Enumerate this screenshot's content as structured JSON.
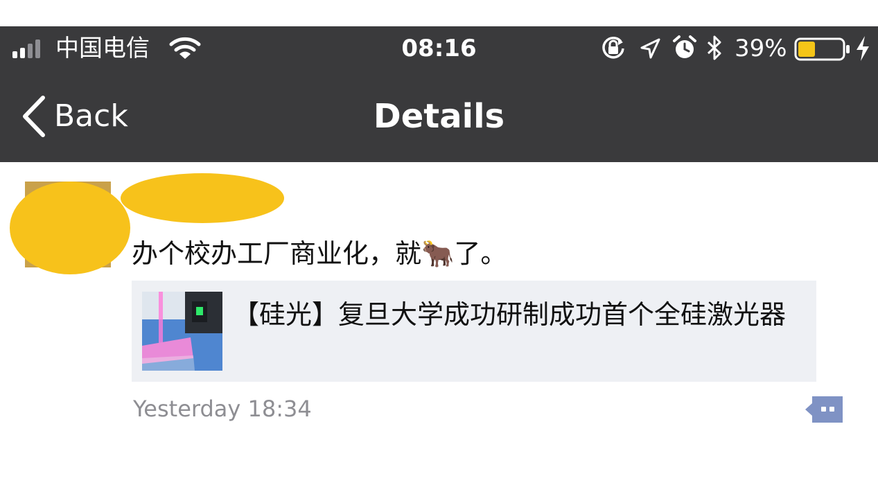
{
  "status_bar": {
    "carrier": "中国电信",
    "time": "08:16",
    "battery_percent": "39%",
    "signal_bars_filled": 2,
    "signal_bars_total": 4,
    "battery_level": 0.39,
    "battery_color": "#f5c518",
    "icons": [
      "signal-icon",
      "wifi-icon",
      "orientation-lock-icon",
      "location-icon",
      "alarm-icon",
      "bluetooth-icon",
      "battery-icon",
      "charging-icon"
    ]
  },
  "nav": {
    "back_label": "Back",
    "title": "Details",
    "background": "#3a3a3c"
  },
  "post": {
    "text": "办个校办工厂商业化，就🐂了。",
    "redaction_color": "#f7c21b",
    "link": {
      "title": "【硅光】复旦大学成功研制成功首个全硅激光器"
    },
    "timestamp": "Yesterday 18:34",
    "comment_icon_color": "#7f92c4"
  }
}
